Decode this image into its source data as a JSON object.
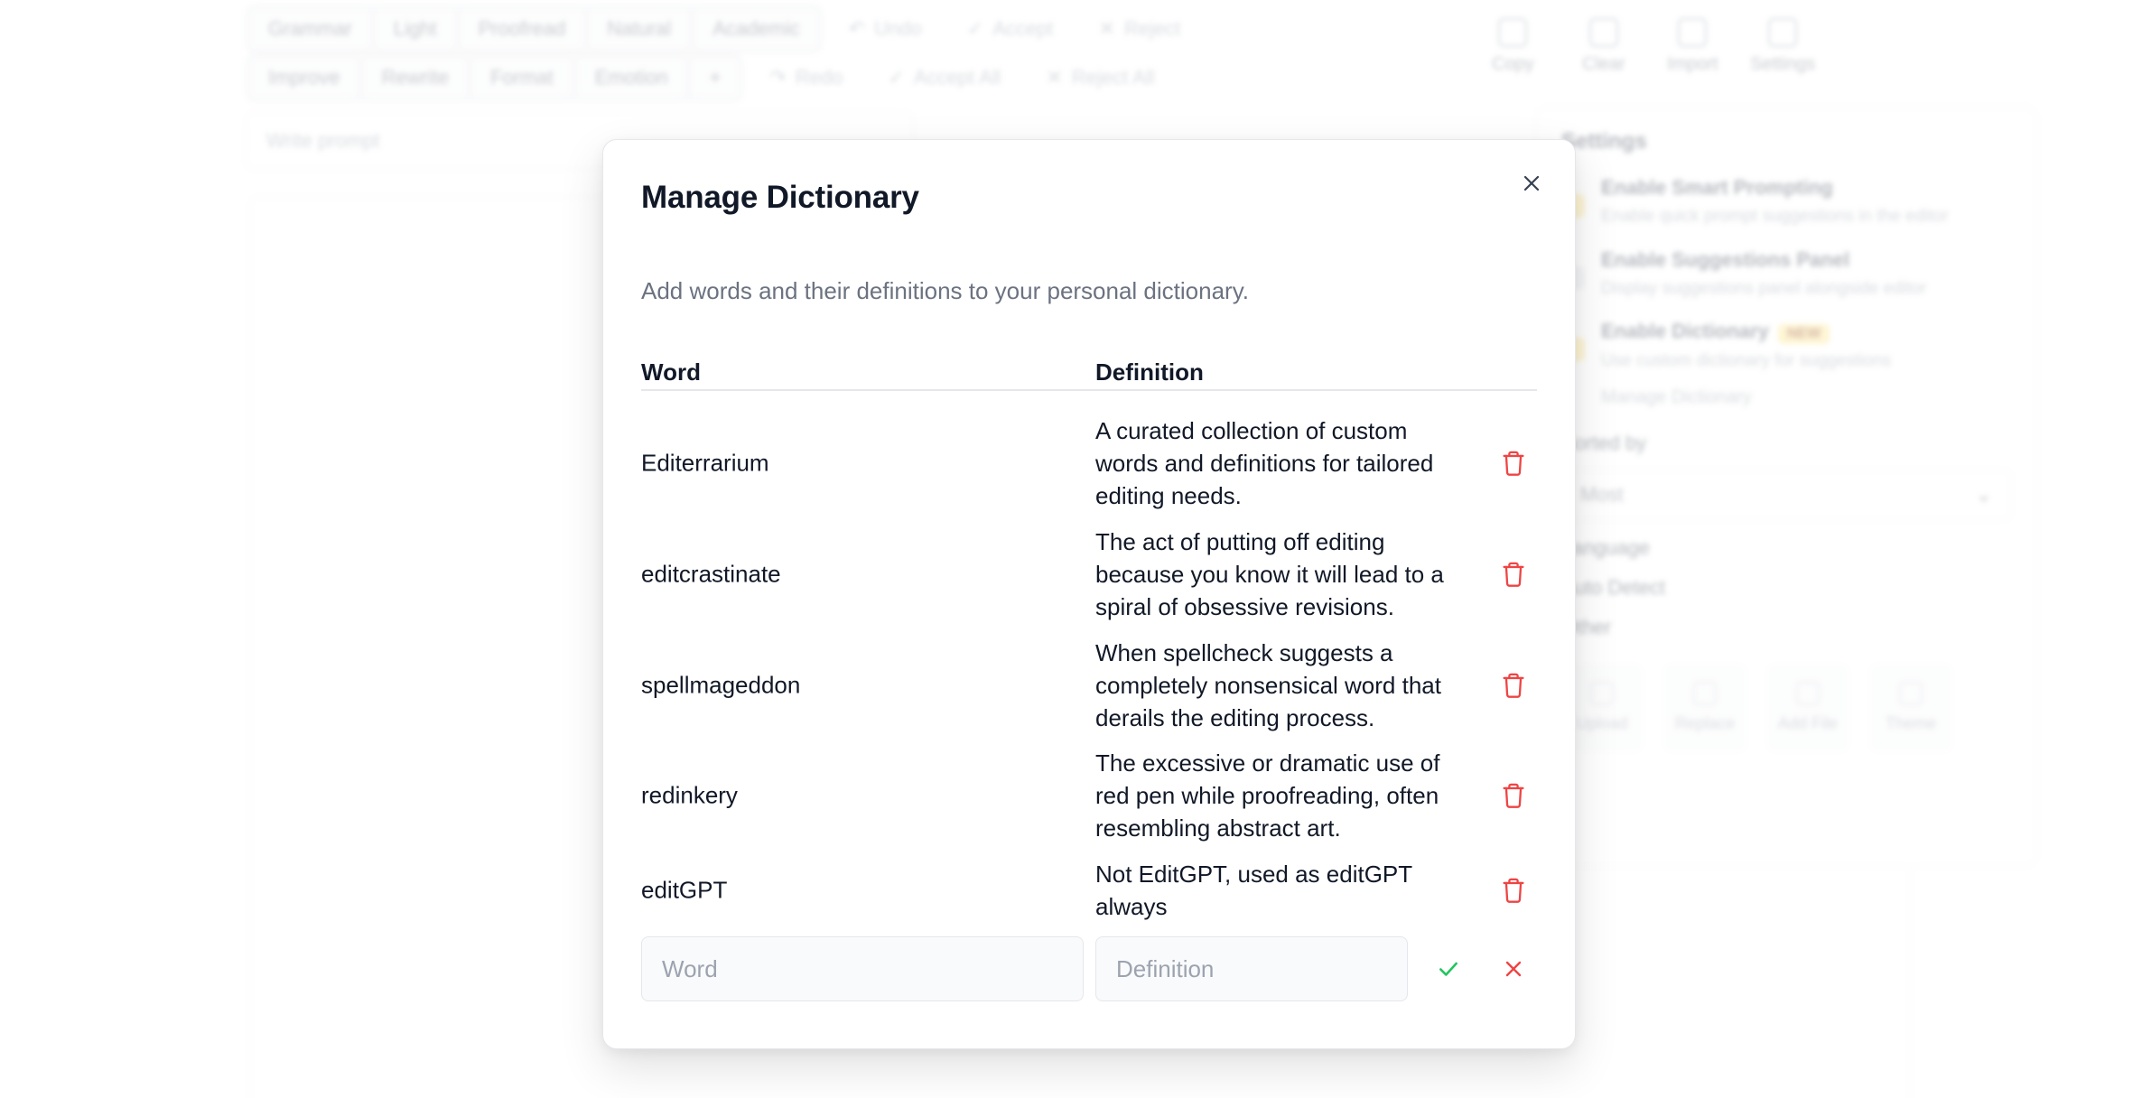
{
  "background": {
    "toolbar_row1": [
      "Grammar",
      "Light",
      "Proofread",
      "Natural",
      "Academic"
    ],
    "toolbar_row1_actions": [
      "Undo",
      "Accept",
      "Reject"
    ],
    "toolbar_row2": [
      "Improve",
      "Rewrite",
      "Format",
      "Emotion"
    ],
    "toolbar_row2_actions": [
      "Redo",
      "Accept All",
      "Reject All"
    ],
    "toolbar_icons": [
      "Copy",
      "Clear",
      "Import",
      "Settings"
    ],
    "prompt_placeholder": "Write prompt",
    "settings": {
      "title": "Settings",
      "options": [
        {
          "title": "Enable Smart Prompting",
          "desc": "Enable quick prompt suggestions in the editor",
          "new": ""
        },
        {
          "title": "Enable Suggestions Panel",
          "desc": "Display suggestions panel alongside editor",
          "new": ""
        },
        {
          "title": "Enable Dictionary",
          "desc": "Use custom dictionary for suggestions",
          "new": "NEW"
        }
      ],
      "manage_link": "Manage Dictionary",
      "sort_label": "Sorted by",
      "sort_value": "Most",
      "language_label": "Language",
      "language_value": "Auto Detect",
      "other_label": "Other",
      "actions": [
        "Upload",
        "Replace",
        "Add File",
        "Theme"
      ]
    }
  },
  "modal": {
    "title": "Manage Dictionary",
    "description": "Add words and their definitions to your personal dictionary.",
    "columns": {
      "word": "Word",
      "definition": "Definition"
    },
    "entries": [
      {
        "word": "Editerrarium",
        "definition": "A curated collection of custom words and definitions for tailored editing needs."
      },
      {
        "word": "editcrastinate",
        "definition": "The act of putting off editing because you know it will lead to a spiral of obsessive revisions."
      },
      {
        "word": "spellmageddon",
        "definition": "When spellcheck suggests a completely nonsensical word that derails the editing process."
      },
      {
        "word": "redinkery",
        "definition": "The excessive or dramatic use of red pen while proofreading, often resembling abstract art."
      },
      {
        "word": "editGPT",
        "definition": "Not EditGPT, used as editGPT always"
      }
    ],
    "new_entry": {
      "word_value": "",
      "word_placeholder": "Word",
      "definition_value": "",
      "definition_placeholder": "Definition"
    }
  },
  "colors": {
    "delete": "#ef4444",
    "confirm": "#22c55e",
    "cancel": "#ef4444",
    "muted_text": "#6b7280",
    "border": "#e5e7eb"
  },
  "icons": {
    "close": "close-icon",
    "delete": "trash-icon",
    "confirm": "check-icon",
    "cancel": "x-icon"
  }
}
